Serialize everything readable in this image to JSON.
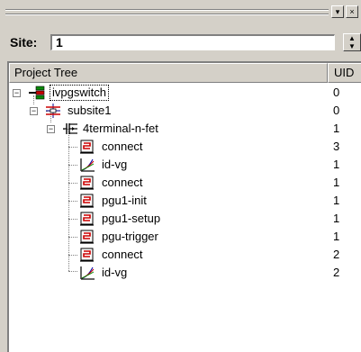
{
  "site": {
    "label": "Site:",
    "value": "1"
  },
  "tree_header": {
    "project_col": "Project Tree",
    "uid_col": "UID"
  },
  "rows": [
    {
      "label": "ivpgswitch",
      "uid": "0",
      "icon": "project-icon",
      "level": 0
    },
    {
      "label": "subsite1",
      "uid": "0",
      "icon": "subsite-icon",
      "level": 1
    },
    {
      "label": "4terminal-n-fet",
      "uid": "1",
      "icon": "device-icon",
      "level": 2
    },
    {
      "label": "connect",
      "uid": "3",
      "icon": "connect-script-icon",
      "level": 3
    },
    {
      "label": "id-vg",
      "uid": "1",
      "icon": "graph-icon",
      "level": 3
    },
    {
      "label": "connect",
      "uid": "1",
      "icon": "connect-script-icon",
      "level": 3
    },
    {
      "label": "pgu1-init",
      "uid": "1",
      "icon": "connect-script-icon",
      "level": 3
    },
    {
      "label": "pgu1-setup",
      "uid": "1",
      "icon": "connect-script-icon",
      "level": 3
    },
    {
      "label": "pgu-trigger",
      "uid": "1",
      "icon": "connect-script-icon",
      "level": 3
    },
    {
      "label": "connect",
      "uid": "2",
      "icon": "connect-script-icon",
      "level": 3
    },
    {
      "label": "id-vg",
      "uid": "2",
      "icon": "graph-icon",
      "level": 3
    }
  ]
}
